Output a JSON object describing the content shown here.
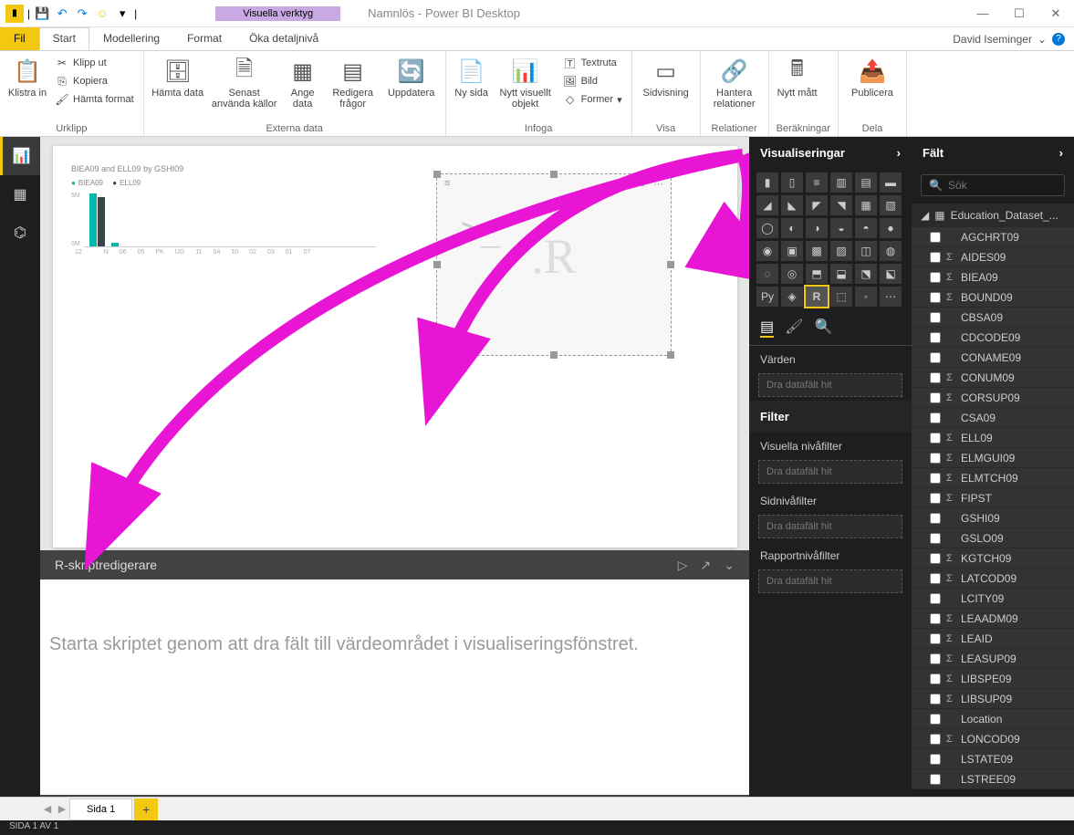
{
  "titlebar": {
    "contextual_tab": "Visuella verktyg",
    "title": "Namnlös - Power BI Desktop"
  },
  "user": {
    "name": "David Iseminger"
  },
  "tabs": {
    "file": "Fil",
    "home": "Start",
    "modeling": "Modellering",
    "format": "Format",
    "drill": "Öka detaljnivå"
  },
  "ribbon": {
    "clipboard": {
      "label": "Urklipp",
      "paste": "Klistra in",
      "cut": "Klipp ut",
      "copy": "Kopiera",
      "format_painter": "Hämta format"
    },
    "external": {
      "label": "Externa data",
      "get_data": "Hämta data",
      "recent": "Senast använda källor",
      "enter": "Ange data",
      "edit": "Redigera frågor",
      "refresh": "Uppdatera"
    },
    "insert": {
      "label": "Infoga",
      "new_page": "Ny sida",
      "new_visual": "Nytt visuellt objekt",
      "textbox": "Textruta",
      "image": "Bild",
      "shapes": "Former"
    },
    "view": {
      "label": "Visa",
      "page_view": "Sidvisning"
    },
    "relations": {
      "label": "Relationer",
      "manage": "Hantera relationer"
    },
    "calc": {
      "label": "Beräkningar",
      "new_measure": "Nytt mått"
    },
    "share": {
      "label": "Dela",
      "publish": "Publicera"
    }
  },
  "viz_pane": {
    "title": "Visualiseringar",
    "values": "Värden",
    "drop_here": "Dra datafält hit",
    "filter": "Filter",
    "visual_filters": "Visuella nivåfilter",
    "page_filters": "Sidnivåfilter",
    "report_filters": "Rapportnivåfilter"
  },
  "fields_pane": {
    "title": "Fält",
    "search_placeholder": "Sök",
    "table": "Education_Dataset_...",
    "fields": [
      {
        "name": "AGCHRT09",
        "agg": false
      },
      {
        "name": "AIDES09",
        "agg": true
      },
      {
        "name": "BIEA09",
        "agg": true
      },
      {
        "name": "BOUND09",
        "agg": true
      },
      {
        "name": "CBSA09",
        "agg": false
      },
      {
        "name": "CDCODE09",
        "agg": false
      },
      {
        "name": "CONAME09",
        "agg": false
      },
      {
        "name": "CONUM09",
        "agg": true
      },
      {
        "name": "CORSUP09",
        "agg": true
      },
      {
        "name": "CSA09",
        "agg": false
      },
      {
        "name": "ELL09",
        "agg": true
      },
      {
        "name": "ELMGUI09",
        "agg": true
      },
      {
        "name": "ELMTCH09",
        "agg": true
      },
      {
        "name": "FIPST",
        "agg": true
      },
      {
        "name": "GSHI09",
        "agg": false
      },
      {
        "name": "GSLO09",
        "agg": false
      },
      {
        "name": "KGTCH09",
        "agg": true
      },
      {
        "name": "LATCOD09",
        "agg": true
      },
      {
        "name": "LCITY09",
        "agg": false
      },
      {
        "name": "LEAADM09",
        "agg": true
      },
      {
        "name": "LEAID",
        "agg": true
      },
      {
        "name": "LEASUP09",
        "agg": true
      },
      {
        "name": "LIBSPE09",
        "agg": true
      },
      {
        "name": "LIBSUP09",
        "agg": true
      },
      {
        "name": "Location",
        "agg": false
      },
      {
        "name": "LONCOD09",
        "agg": true
      },
      {
        "name": "LSTATE09",
        "agg": false
      },
      {
        "name": "LSTREE09",
        "agg": false
      }
    ]
  },
  "r_editor": {
    "title": "R-skriptredigerare",
    "placeholder": "Starta skriptet genom att dra fält till värdeområdet i visualiseringsfönstret."
  },
  "chart_data": {
    "type": "bar",
    "title": "BIEA09 and ELL09 by GSHI09",
    "series": [
      {
        "name": "BIEA09"
      },
      {
        "name": "ELL09"
      }
    ],
    "categories": [
      "12",
      "",
      "N",
      "06",
      "05",
      "PK",
      "UG",
      "11",
      "04",
      "10",
      "02",
      "03",
      "01",
      "07"
    ],
    "ylabel": "",
    "ylim": [
      0,
      5
    ]
  },
  "page_tabs": {
    "page1": "Sida 1"
  },
  "statusbar": {
    "text": "SIDA 1 AV 1"
  }
}
